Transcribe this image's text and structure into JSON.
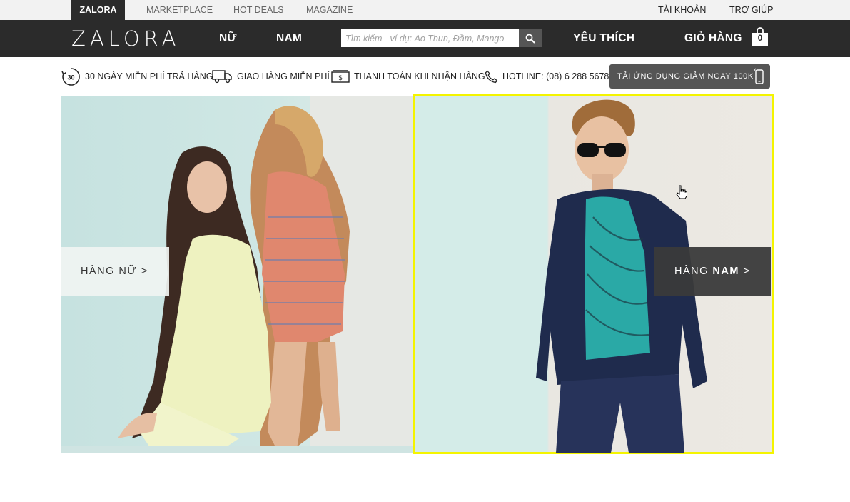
{
  "topbar": {
    "tabs": [
      "ZALORA",
      "MARKETPLACE",
      "HOT DEALS",
      "MAGAZINE"
    ],
    "right": [
      "TÀI KHOẢN",
      "TRỢ GIÚP"
    ]
  },
  "header": {
    "logo": "ZALORA",
    "nav": [
      "NỮ",
      "NAM"
    ],
    "search_placeholder": "Tìm kiếm - ví dụ: Áo Thun, Đầm, Mango",
    "favorites": "YÊU THÍCH",
    "cart": "GIỎ HÀNG",
    "cart_count": "0"
  },
  "usp": {
    "returns_badge": "30",
    "returns": "30 NGÀY MIỄN PHÍ TRẢ HÀNG",
    "shipping": "GIAO HÀNG MIỄN PHÍ",
    "cod": "THANH TOÁN KHI NHẬN HÀNG",
    "hotline": "HOTLINE: (08) 6 288 5678",
    "app_promo": "TẢI ỨNG DỤNG GIẢM NGAY 100K"
  },
  "banners": {
    "women_cta": "HÀNG NỮ >",
    "men_cta_prefix": "HÀNG ",
    "men_cta_bold": "NAM",
    "men_cta_suffix": " >"
  },
  "colors": {
    "header_bg": "#2b2b2b",
    "topbar_bg": "#f2f2f2",
    "button_bg": "#555555",
    "highlight": "#f4f400"
  }
}
